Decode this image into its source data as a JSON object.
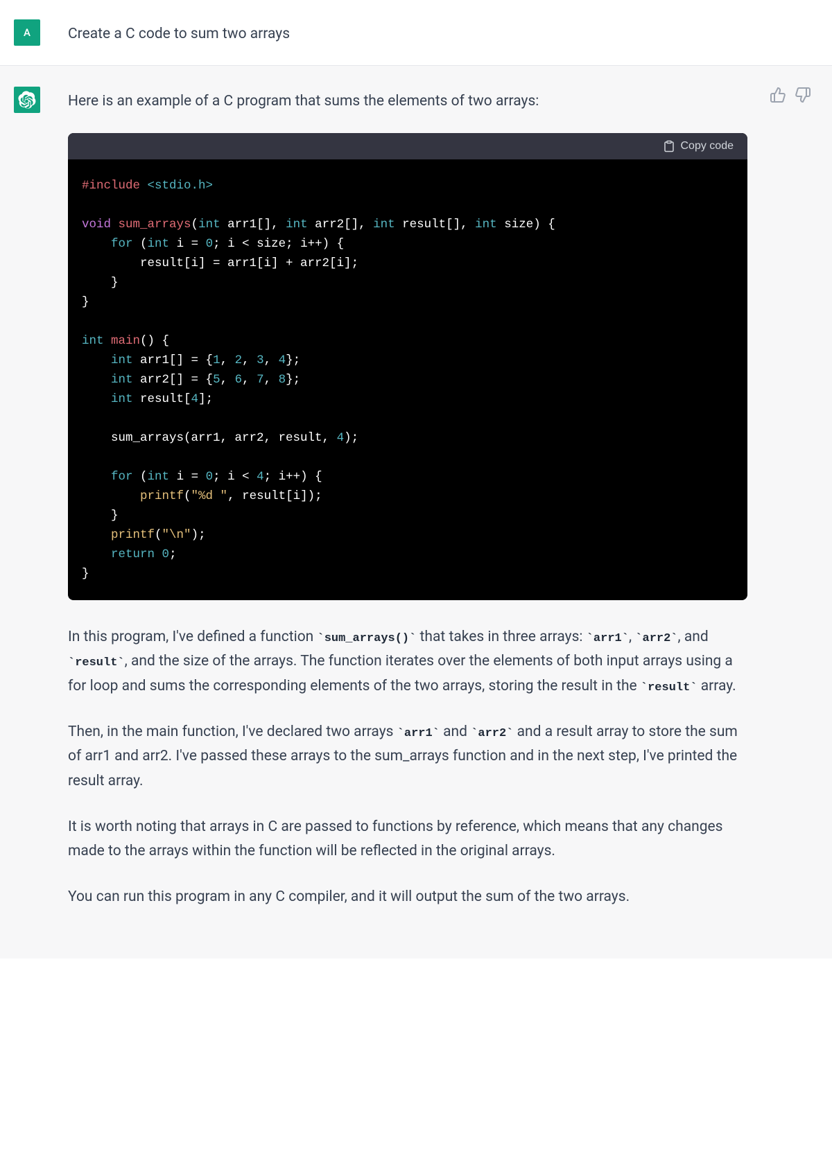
{
  "user": {
    "avatar_letter": "A",
    "prompt": "Create a C code to sum two arrays"
  },
  "assistant": {
    "intro": "Here is an example of a C program that sums the elements of two arrays:",
    "copy_label": "Copy code",
    "code": {
      "include_directive": "#include",
      "include_header": " <stdio.h>",
      "void_kw": "void",
      "func_name": " sum_arrays",
      "sig_open": "(",
      "int_kw": "int",
      "arr1_param": " arr1[], ",
      "arr2_param": " arr2[], ",
      "result_param": " result[], ",
      "size_param": " size",
      "sig_close": ") {",
      "for_kw": "for",
      "for1_open": " (",
      "for1_decl": " i = ",
      "zero": "0",
      "for1_cond": "; i < size; i++) {",
      "body1": "        result[i] = arr1[i] + arr2[i];",
      "close_brace1": "    }",
      "close_brace2": "}",
      "main_kw": " main",
      "main_sig": "() {",
      "arr1_decl_a": " arr1[] = {",
      "n1": "1",
      "n2": "2",
      "n3": "3",
      "n4": "4",
      "arr_close": "};",
      "arr2_decl_a": " arr2[] = {",
      "n5": "5",
      "n6": "6",
      "n7": "7",
      "n8": "8",
      "result_decl": " result[",
      "four": "4",
      "result_close": "];",
      "call_sum": "    sum_arrays(arr1, arr2, result, ",
      "call_close": ");",
      "for2_cond": "; i < ",
      "for2_end": "; i++) {",
      "printf_name": "printf",
      "printf_fmt": "\"%d \"",
      "printf_args": ", result[i]);",
      "printf_nl": "\"\\n\"",
      "printf_nl_close": ");",
      "return_kw": "return",
      "return_val": " ",
      "semicolon": ";",
      "comma_sep": ", ",
      "indent4": "    ",
      "indent8": "        "
    },
    "para1_a": "In this program, I've defined a function ",
    "para1_code1": "`sum_arrays()`",
    "para1_b": " that takes in three arrays: ",
    "para1_code2": "`arr1`",
    "para1_c": ", ",
    "para1_code3": "`arr2`",
    "para1_d": ", and ",
    "para1_code4": "`result`",
    "para1_e": ", and the size of the arrays. The function iterates over the elements of both input arrays using a for loop and sums the corresponding elements of the two arrays, storing the result in the ",
    "para1_code5": "`result`",
    "para1_f": " array.",
    "para2_a": "Then, in the main function, I've declared two arrays ",
    "para2_code1": "`arr1`",
    "para2_b": " and ",
    "para2_code2": "`arr2`",
    "para2_c": " and a result array to store the sum of arr1 and arr2. I've passed these arrays to the sum_arrays function and in the next step, I've printed the result array.",
    "para3": "It is worth noting that arrays in C are passed to functions by reference, which means that any changes made to the arrays within the function will be reflected in the original arrays.",
    "para4": "You can run this program in any C compiler, and it will output the sum of the two arrays."
  }
}
